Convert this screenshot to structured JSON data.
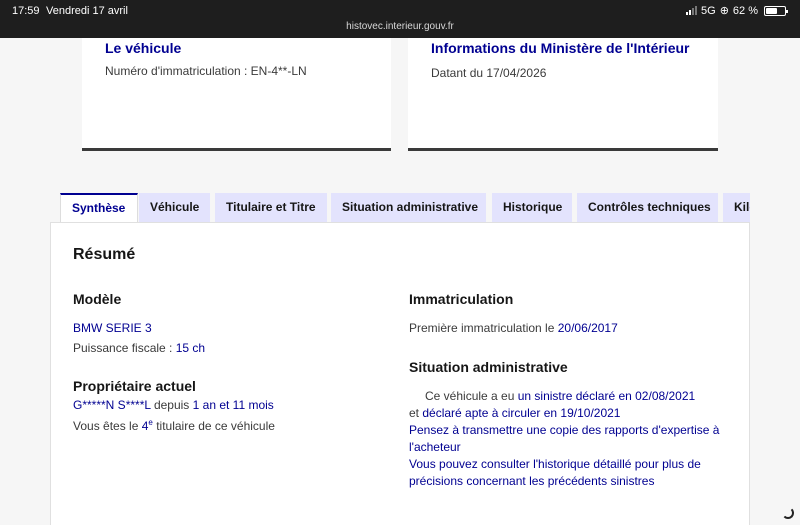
{
  "status_bar": {
    "time": "17:59",
    "date": "Vendredi 17 avril",
    "url": "histovec.interieur.gouv.fr",
    "network": "5G",
    "battery_percent": "62 %",
    "battery_level": 0.62
  },
  "cards": {
    "vehicule": {
      "title": "Le véhicule",
      "plate_label": "Numéro d'immatriculation : ",
      "plate_value": "EN-4**-LN"
    },
    "ministere": {
      "title": "Informations du Ministère de l'Intérieur",
      "date_label": "Datant du ",
      "date_value": "17/04/2026"
    }
  },
  "tabs": [
    {
      "label": "Synthèse",
      "active": true
    },
    {
      "label": "Véhicule",
      "active": false
    },
    {
      "label": "Titulaire et Titre",
      "active": false
    },
    {
      "label": "Situation administrative",
      "active": false
    },
    {
      "label": "Historique",
      "active": false
    },
    {
      "label": "Contrôles techniques",
      "active": false
    },
    {
      "label": "Kilo",
      "active": false
    }
  ],
  "summary": {
    "heading": "Résumé",
    "modele": {
      "heading": "Modèle",
      "model_name": "BMW SERIE 3",
      "puissance_label": "Puissance fiscale : ",
      "puissance_value": "15 ch"
    },
    "proprietaire": {
      "heading": "Propriétaire actuel",
      "name": "G*****N S****L",
      "since_label": " depuis ",
      "since_value": "1 an et 11 mois",
      "rank_prefix": "Vous êtes le ",
      "rank_value": "4",
      "rank_suffix": "e",
      "rank_after": " titulaire de ce véhicule"
    },
    "immatriculation": {
      "heading": "Immatriculation",
      "label": "Première immatriculation le ",
      "value": "20/06/2017"
    },
    "situation": {
      "heading": "Situation administrative",
      "line1_prefix": "Ce véhicule a eu ",
      "line1_link": "un sinistre déclaré en 02/08/2021",
      "line2_prefix": "et ",
      "line2_link": "déclaré apte à circuler en 19/10/2021",
      "line3": "Pensez à transmettre une copie des rapports d'expertise à l'acheteur",
      "line4": "Vous pouvez consulter l'historique détaillé pour plus de précisions concernant les précédents sinistres"
    }
  }
}
